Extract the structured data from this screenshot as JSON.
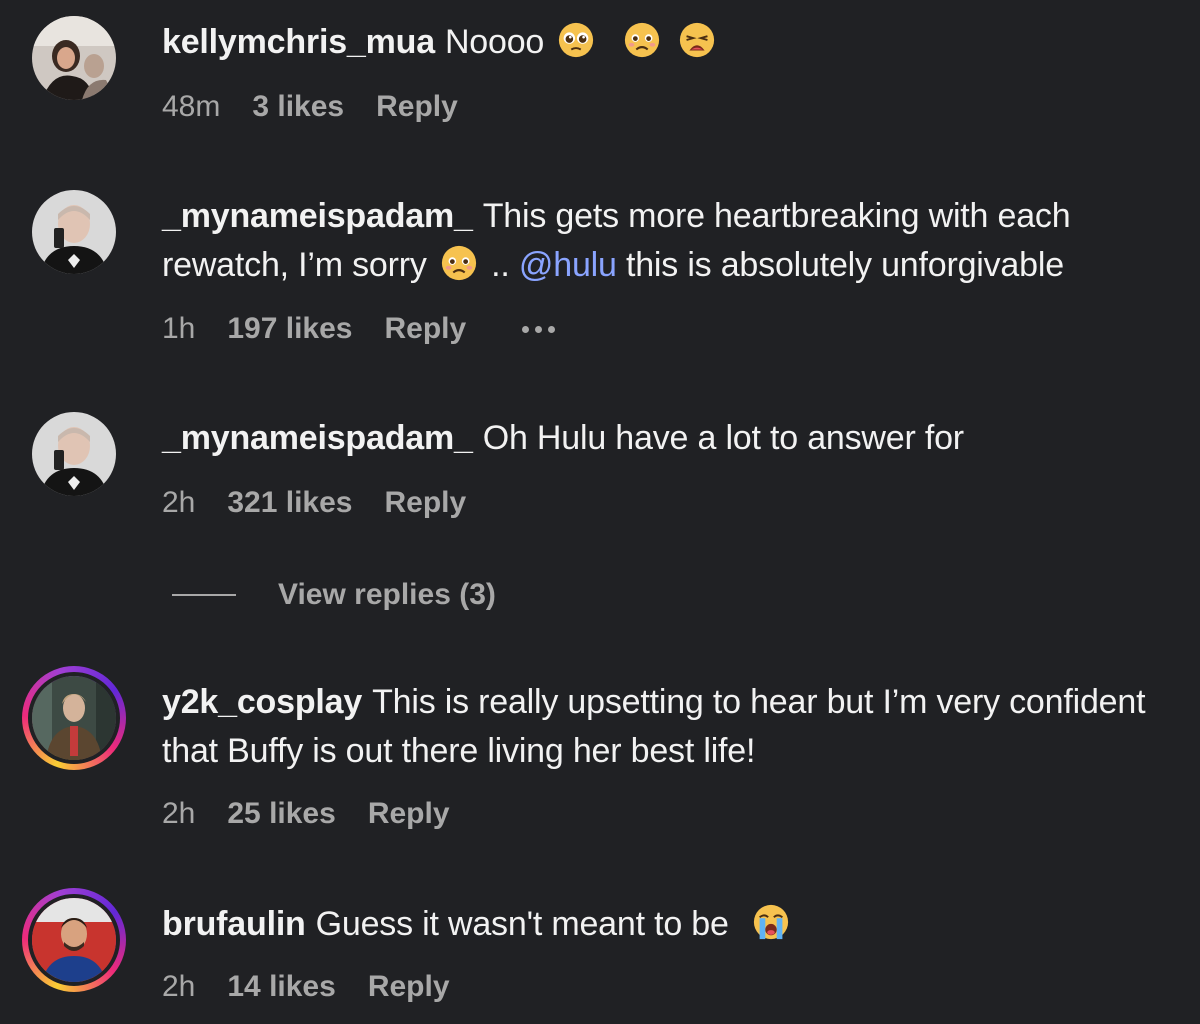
{
  "comments": [
    {
      "username": "kellymchris_mua",
      "text": "Noooo",
      "emojis": [
        "pleading-face",
        "worried-face",
        "weary-face"
      ],
      "time": "48m",
      "likes": "3 likes",
      "reply": "Reply"
    },
    {
      "username": "_mynameispadam_",
      "text_before": "This gets more heartbreaking with each rewatch, I’m sorry",
      "emoji": "worried-face",
      "text_mid": "..",
      "mention": "@hulu",
      "text_after": "this is absolutely unforgivable",
      "time": "1h",
      "likes": "197 likes",
      "reply": "Reply"
    },
    {
      "username": "_mynameispadam_",
      "text": "Oh Hulu have a lot to answer for",
      "time": "2h",
      "likes": "321 likes",
      "reply": "Reply",
      "view_replies": "View replies (3)"
    },
    {
      "username": "y2k_cosplay",
      "text": "This is really upsetting to hear but I’m very confident that Buffy is out there living her best life!",
      "time": "2h",
      "likes": "25 likes",
      "reply": "Reply"
    },
    {
      "username": "brufaulin",
      "text": "Guess it wasn't meant to be",
      "emoji": "loudly-crying-face",
      "time": "2h",
      "likes": "14 likes",
      "reply": "Reply"
    }
  ],
  "colors": {
    "background": "#202124",
    "text": "#f2f2f2",
    "meta": "#a8a8a8",
    "mention": "#8aa4ff"
  }
}
